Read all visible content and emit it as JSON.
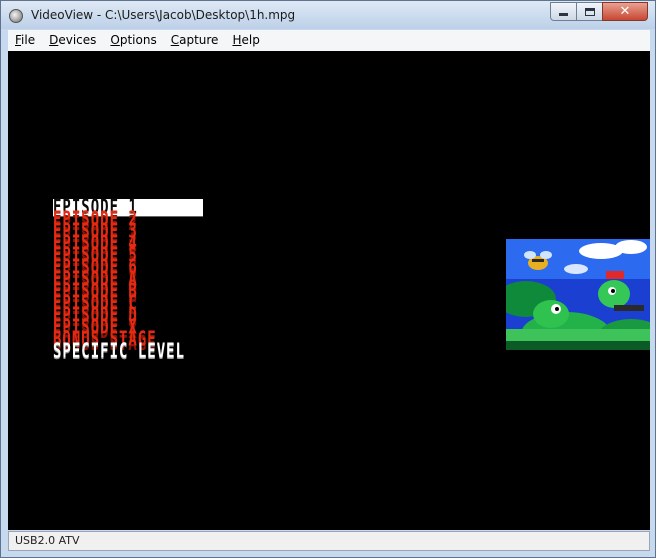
{
  "window": {
    "title": "VideoView - C:\\Users\\Jacob\\Desktop\\1h.mpg",
    "app_icon": "videoview-app-icon",
    "controls": {
      "minimize_icon": "minimize-icon",
      "maximize_icon": "maximize-icon",
      "close_icon": "close-icon",
      "close_glyph": "✕"
    }
  },
  "menu": [
    {
      "accel": "F",
      "rest": "ile"
    },
    {
      "accel": "D",
      "rest": "evices"
    },
    {
      "accel": "O",
      "rest": "ptions"
    },
    {
      "accel": "C",
      "rest": "apture"
    },
    {
      "accel": "H",
      "rest": "elp"
    }
  ],
  "game_menu": {
    "items": [
      {
        "label": "EPISODE  1",
        "style": "selected"
      },
      {
        "label": "EPISODE  2",
        "style": "red"
      },
      {
        "label": "EPISODE  3",
        "style": "red"
      },
      {
        "label": "EPISODE  4",
        "style": "red"
      },
      {
        "label": "EPISODE  5",
        "style": "red"
      },
      {
        "label": "EPISODE  6",
        "style": "red"
      },
      {
        "label": "EPISODE  A",
        "style": "red"
      },
      {
        "label": "EPISODE  B",
        "style": "red"
      },
      {
        "label": "EPISODE  C",
        "style": "red"
      },
      {
        "label": "EPISODE  D",
        "style": "red"
      },
      {
        "label": "EPISODE  X",
        "style": "red"
      },
      {
        "label": "BONUS STAGE",
        "style": "red"
      },
      {
        "label": "SPECIFIC LEVEL",
        "style": "white"
      }
    ],
    "colors": {
      "red": "#e52a13",
      "white": "#ffffff",
      "selected_bg": "#ffffff"
    }
  },
  "preview_art": {
    "description_icon": "episode-preview-artwork"
  },
  "status": {
    "text": "USB2.0 ATV"
  }
}
